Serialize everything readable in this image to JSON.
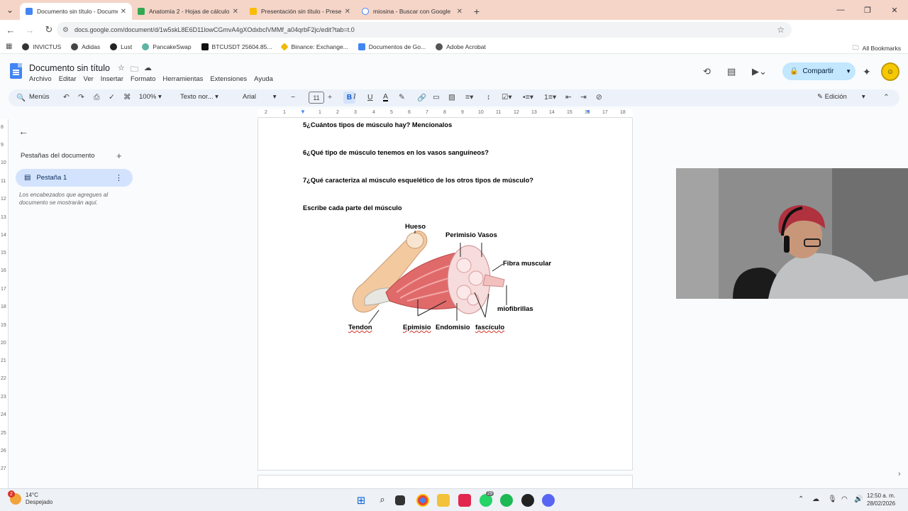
{
  "browser": {
    "tabs": [
      {
        "title": "Documento sin título - Docume",
        "color": "#4285f4",
        "active": true
      },
      {
        "title": "Anatomía 2 - Hojas de cálculo",
        "color": "#34a853",
        "active": false
      },
      {
        "title": "Presentación sin título - Prese",
        "color": "#fbbc04",
        "active": false
      },
      {
        "title": "miosina - Buscar con Google",
        "color": "#ffffff",
        "active": false
      }
    ],
    "url": "docs.google.com/document/d/1w5skL8E6D11lowCGmvA4gXOdxbclVMMf_a04qrbF2jc/edit?tab=t.0",
    "bookmarks": [
      "INVICTUS",
      "Adidas",
      "Lust",
      "PancakeSwap",
      "BTCUSDT 25604.85...",
      "Binance: Exchange...",
      "Documentos de Go...",
      "Adobe Acrobat"
    ],
    "all_bookmarks": "All Bookmarks"
  },
  "doc": {
    "title": "Documento sin título",
    "menus": [
      "Archivo",
      "Editar",
      "Ver",
      "Insertar",
      "Formato",
      "Herramientas",
      "Extensiones",
      "Ayuda"
    ],
    "share_label": "Compartir",
    "toolbar": {
      "menus_label": "Menús",
      "zoom": "100%",
      "style": "Texto nor...",
      "font": "Arial",
      "size": "11",
      "bold": "B",
      "italic": "I",
      "underline": "U",
      "mode": "Edición"
    },
    "ruler_numbers": [
      "2",
      "1",
      "1",
      "2",
      "3",
      "4",
      "5",
      "6",
      "7",
      "8",
      "9",
      "10",
      "11",
      "12",
      "13",
      "14",
      "15",
      "16",
      "17",
      "18"
    ],
    "vruler_numbers": [
      "8",
      "9",
      "10",
      "11",
      "12",
      "13",
      "14",
      "15",
      "16",
      "17",
      "18",
      "19",
      "20",
      "21",
      "22",
      "23",
      "24",
      "25",
      "26",
      "27"
    ],
    "sidebar": {
      "title": "Pestañas del documento",
      "tab_label": "Pestaña 1",
      "hint": "Los encabezados que agregues al documento se mostrarán aquí."
    },
    "questions": [
      "5¿Cuántos tipos de músculo hay? Mencionalos",
      "6¿Qué tipo de músculo tenemos en los vasos sanguíneos?",
      "7¿Qué caracteriza al músculo esquelético de los otros tipos de músculo?",
      "Escribe cada parte del músculo"
    ],
    "diagram_labels": {
      "hueso": "Hueso",
      "perimisio_vasos": "Perimisio Vasos",
      "fibra": "Fibra muscular",
      "miofibrillas": "miofibrillas",
      "tendon": "Tendon",
      "epimisio": "Epimisio",
      "endomisio": "Endomisio",
      "fasciculo": "fascículo"
    }
  },
  "taskbar": {
    "temperature": "14°C",
    "weather": "Despejado",
    "weather_badge": "2",
    "whatsapp_badge": "29",
    "time": "12:50 a. m.",
    "date": "28/02/2026"
  }
}
